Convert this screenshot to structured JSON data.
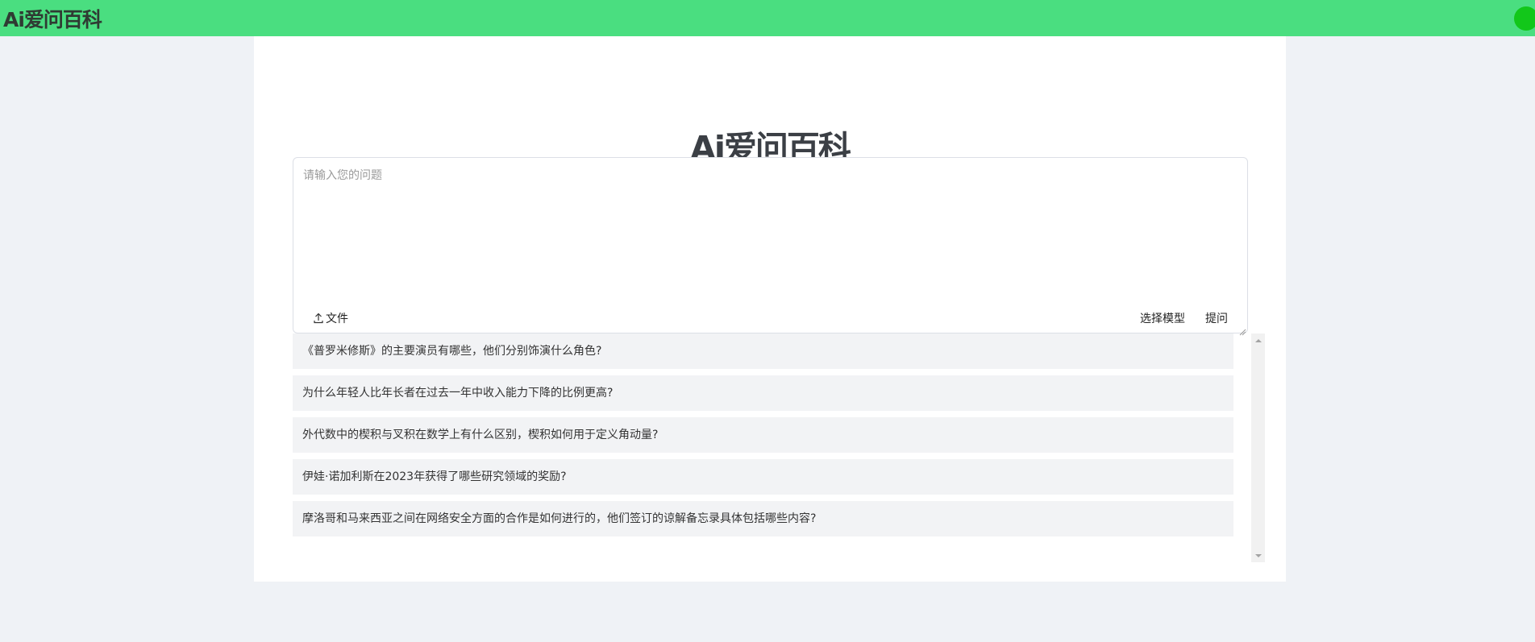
{
  "header": {
    "brand": "Ai爱问百科"
  },
  "main": {
    "title": "Ai爱问百科",
    "question_placeholder": "请输入您的问题",
    "question_value": "",
    "file_label": "文件",
    "model_label": "选择模型",
    "ask_label": "提问"
  },
  "suggestions": [
    "《普罗米修斯》的主要演员有哪些，他们分别饰演什么角色?",
    "为什么年轻人比年长者在过去一年中收入能力下降的比例更高?",
    "外代数中的楔积与叉积在数学上有什么区别，楔积如何用于定义角动量?",
    "伊娃·诺加利斯在2023年获得了哪些研究领域的奖励?",
    "摩洛哥和马来西亚之间在网络安全方面的合作是如何进行的，他们签订的谅解备忘录具体包括哪些内容?"
  ],
  "icons": {
    "upload": "upload-icon",
    "avatar": "avatar",
    "scroll_up": "chevron-up-icon",
    "scroll_down": "chevron-down-icon"
  },
  "colors": {
    "header_bg": "#4ade80",
    "avatar": "#12c71a",
    "page_bg": "#eff2f6",
    "suggestion_bg": "#f2f3f5"
  }
}
